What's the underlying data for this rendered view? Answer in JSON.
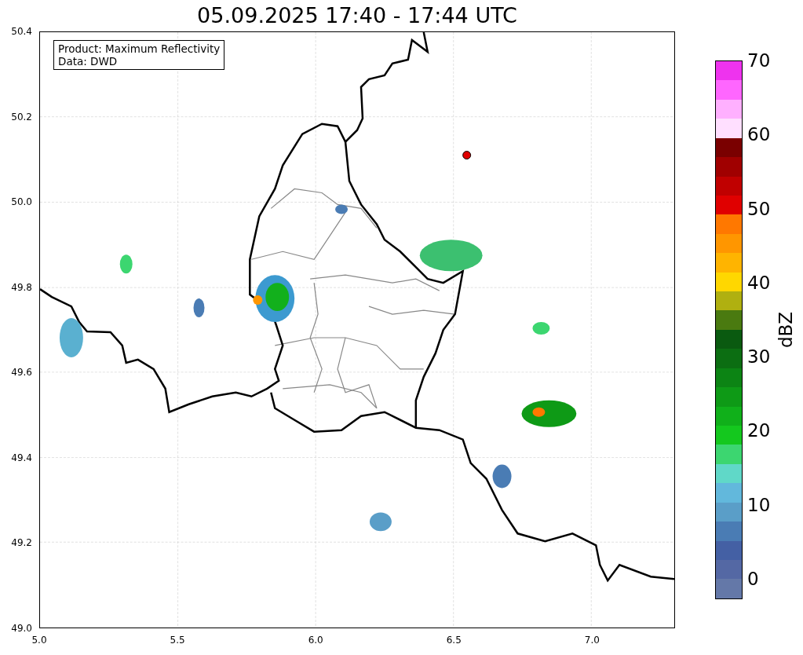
{
  "title": "05.09.2025 17:40 - 17:44 UTC",
  "legend": [
    "Product: Maximum Reflectivity",
    "Data: DWD"
  ],
  "y_ticks": [
    "50.4",
    "50.2",
    "50.0",
    "49.8",
    "49.6",
    "49.4",
    "49.2",
    "49.0"
  ],
  "x_ticks": [
    "5.0",
    "5.5",
    "6.0",
    "6.5",
    "7.0"
  ],
  "colorbar": {
    "label": "dBZ",
    "ticks": [
      "70",
      "60",
      "50",
      "40",
      "30",
      "20",
      "10",
      "0"
    ],
    "segments": [
      {
        "color": "#ee33ee"
      },
      {
        "color": "#ff66ff"
      },
      {
        "color": "#ffb0ff"
      },
      {
        "color": "#ffdfff"
      },
      {
        "color": "#7a0000"
      },
      {
        "color": "#a00000"
      },
      {
        "color": "#c00000"
      },
      {
        "color": "#e00000"
      },
      {
        "color": "#ff7800"
      },
      {
        "color": "#ff9600"
      },
      {
        "color": "#ffb400"
      },
      {
        "color": "#ffd700"
      },
      {
        "color": "#b0b010"
      },
      {
        "color": "#4a7a10"
      },
      {
        "color": "#0a5a10"
      },
      {
        "color": "#0c6e12"
      },
      {
        "color": "#0c8414"
      },
      {
        "color": "#0e9a16"
      },
      {
        "color": "#10b01a"
      },
      {
        "color": "#14c81e"
      },
      {
        "color": "#3cd670"
      },
      {
        "color": "#60d8c8"
      },
      {
        "color": "#62b8dc"
      },
      {
        "color": "#5a9ec8"
      },
      {
        "color": "#4a7cb4"
      },
      {
        "color": "#4460a4"
      },
      {
        "color": "#5468a4"
      },
      {
        "color": "#6478a8"
      }
    ]
  }
}
